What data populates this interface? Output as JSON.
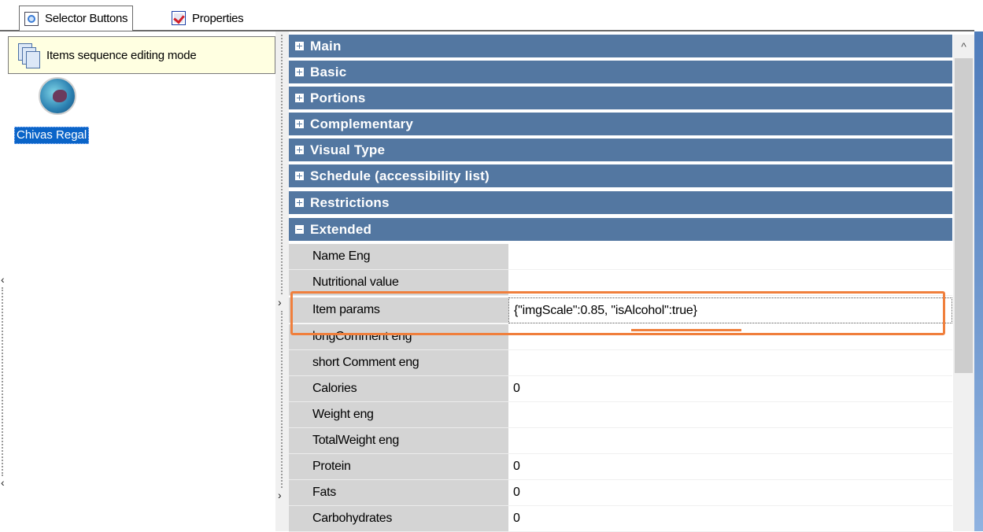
{
  "tabs": [
    {
      "label": "Selector Buttons",
      "icon": "selector-icon",
      "active": true
    },
    {
      "label": "Properties",
      "icon": "properties-icon",
      "active": false
    }
  ],
  "left_pane": {
    "banner_text": "Items sequence editing mode",
    "banner_icon": "sequence-icon",
    "item": {
      "label": "Chivas Regal",
      "icon": "item-logo-icon"
    }
  },
  "categories": {
    "main": "Main",
    "basic": "Basic",
    "portions": "Portions",
    "complementary": "Complementary",
    "visual_type": "Visual Type",
    "schedule": "Schedule (accessibility list)",
    "restrictions": "Restrictions",
    "extended": "Extended"
  },
  "extended_rows": [
    {
      "name": "Name Eng",
      "value": ""
    },
    {
      "name": "Nutritional value",
      "value": ""
    },
    {
      "name": "Item params",
      "value": "{\"imgScale\":0.85, \"isAlcohol\":true}"
    },
    {
      "name": "longComment eng",
      "value": ""
    },
    {
      "name": "short Comment eng",
      "value": ""
    },
    {
      "name": "Calories",
      "value": "0"
    },
    {
      "name": "Weight eng",
      "value": ""
    },
    {
      "name": "TotalWeight eng",
      "value": ""
    },
    {
      "name": "Protein",
      "value": "0"
    },
    {
      "name": "Fats",
      "value": "0"
    },
    {
      "name": "Carbohydrates",
      "value": "0"
    }
  ],
  "colors": {
    "category_header": "#5377a1",
    "name_column": "#d4d4d4",
    "highlight": "#f07f3c",
    "selection": "#0a64c8",
    "banner": "#ffffe1"
  }
}
